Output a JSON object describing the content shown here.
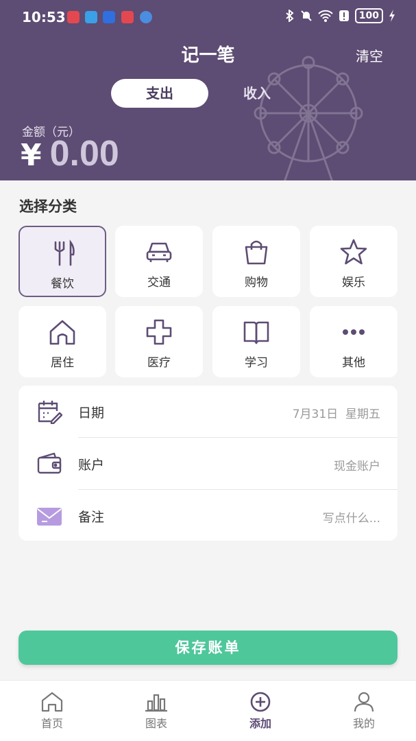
{
  "statusbar": {
    "time": "10:53",
    "battery": "100"
  },
  "header": {
    "title": "记一笔",
    "clear_label": "清空",
    "tabs": {
      "expense": "支出",
      "income": "收入"
    },
    "amount_label": "金额（元）",
    "currency": "¥",
    "amount": "0.00"
  },
  "category": {
    "title": "选择分类",
    "items": [
      {
        "label": "餐饮",
        "icon": "utensils-icon"
      },
      {
        "label": "交通",
        "icon": "car-icon"
      },
      {
        "label": "购物",
        "icon": "shopping-bag-icon"
      },
      {
        "label": "娱乐",
        "icon": "star-icon"
      },
      {
        "label": "居住",
        "icon": "house-icon"
      },
      {
        "label": "医疗",
        "icon": "medical-cross-icon"
      },
      {
        "label": "学习",
        "icon": "book-icon"
      },
      {
        "label": "其他",
        "icon": "more-dots-icon"
      }
    ],
    "selected": "餐饮"
  },
  "form": {
    "date": {
      "label": "日期",
      "value": "7月31日  星期五"
    },
    "account": {
      "label": "账户",
      "value": "现金账户"
    },
    "note": {
      "label": "备注",
      "placeholder": "写点什么..."
    }
  },
  "save_label": "保存账单",
  "nav": {
    "items": [
      {
        "label": "首页",
        "icon": "home-icon"
      },
      {
        "label": "图表",
        "icon": "bar-chart-icon"
      },
      {
        "label": "添加",
        "icon": "add-circle-icon"
      },
      {
        "label": "我的",
        "icon": "user-icon"
      }
    ],
    "active": "添加"
  },
  "colors": {
    "header": "#5d4c73",
    "accent": "#6e5c84",
    "save": "#4ec79b",
    "note_icon": "#b79be0"
  }
}
